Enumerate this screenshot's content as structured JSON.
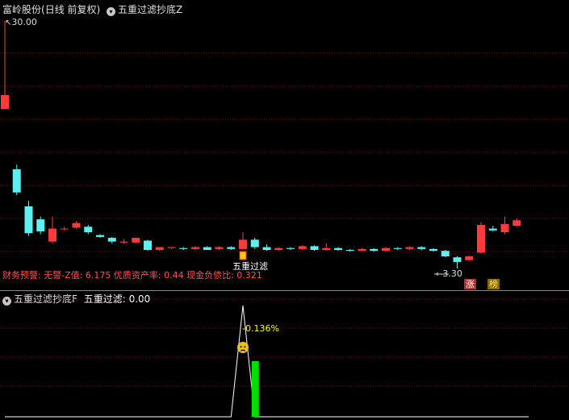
{
  "header": {
    "stock_name": "富岭股份",
    "period": "(日线 前复权)",
    "indicator_name": "五重过滤抄底Z"
  },
  "main_chart": {
    "high_label": "30.00",
    "low_label": "3.30",
    "signal_label": "五重过滤",
    "finance_warning": "财务预警: 无警-Z值: 6.175 优质资产率: 0.44 现金负债比: 0.321",
    "badges": [
      "涨",
      "榜"
    ],
    "colors": {
      "up": "#ff3a3a",
      "down": "#5cf0f0",
      "grid": "#7a0000",
      "badge_up": "#b03030",
      "badge_list": "#c8a000"
    }
  },
  "sub_chart": {
    "title": "五重过滤抄底F",
    "value_label": "五重过滤: 0.00",
    "pct_label": "-0.136%",
    "face_icon": "sad-face-icon",
    "colors": {
      "bar": "#00e000",
      "line": "#ffffff",
      "pct_text": "#ffff00"
    }
  },
  "chart_data": {
    "type": "candlestick",
    "title": "五重过滤抄底Z",
    "candles": [
      {
        "o": 22.0,
        "c": 20.5,
        "h": 30.0,
        "l": 20.5,
        "up": true
      },
      {
        "o": 14.0,
        "c": 11.5,
        "h": 14.5,
        "l": 11.2,
        "up": false
      },
      {
        "o": 10.0,
        "c": 7.1,
        "h": 10.6,
        "l": 6.8,
        "up": false
      },
      {
        "o": 8.6,
        "c": 7.3,
        "h": 8.9,
        "l": 7.0,
        "up": false
      },
      {
        "o": 6.2,
        "c": 7.6,
        "h": 8.9,
        "l": 6.0,
        "up": true
      },
      {
        "o": 7.6,
        "c": 7.6,
        "h": 7.8,
        "l": 7.4,
        "up": true
      },
      {
        "o": 7.7,
        "c": 8.2,
        "h": 8.4,
        "l": 7.6,
        "up": true
      },
      {
        "o": 7.8,
        "c": 7.2,
        "h": 8.0,
        "l": 7.0,
        "up": false
      },
      {
        "o": 6.9,
        "c": 6.7,
        "h": 7.0,
        "l": 6.6,
        "up": false
      },
      {
        "o": 6.6,
        "c": 6.2,
        "h": 6.7,
        "l": 6.0,
        "up": false
      },
      {
        "o": 6.1,
        "c": 6.2,
        "h": 6.5,
        "l": 6.0,
        "up": true
      },
      {
        "o": 6.1,
        "c": 6.6,
        "h": 6.6,
        "l": 6.0,
        "up": true
      },
      {
        "o": 6.3,
        "c": 5.3,
        "h": 6.4,
        "l": 5.2,
        "up": false
      },
      {
        "o": 5.3,
        "c": 5.6,
        "h": 5.6,
        "l": 5.2,
        "up": true
      },
      {
        "o": 5.5,
        "c": 5.6,
        "h": 5.6,
        "l": 5.4,
        "up": true
      },
      {
        "o": 5.5,
        "c": 5.4,
        "h": 5.6,
        "l": 5.3,
        "up": false
      },
      {
        "o": 5.4,
        "c": 5.6,
        "h": 5.7,
        "l": 5.3,
        "up": true
      },
      {
        "o": 5.6,
        "c": 5.3,
        "h": 5.7,
        "l": 5.3,
        "up": false
      },
      {
        "o": 5.4,
        "c": 5.6,
        "h": 5.7,
        "l": 5.3,
        "up": true
      },
      {
        "o": 5.6,
        "c": 5.4,
        "h": 5.7,
        "l": 5.3,
        "up": false
      },
      {
        "o": 5.4,
        "c": 6.4,
        "h": 7.2,
        "l": 5.3,
        "up": true
      },
      {
        "o": 6.4,
        "c": 5.6,
        "h": 6.6,
        "l": 5.4,
        "up": false
      },
      {
        "o": 5.6,
        "c": 5.3,
        "h": 5.9,
        "l": 5.2,
        "up": false
      },
      {
        "o": 5.3,
        "c": 5.5,
        "h": 5.6,
        "l": 5.2,
        "up": true
      },
      {
        "o": 5.5,
        "c": 5.4,
        "h": 5.6,
        "l": 5.3,
        "up": false
      },
      {
        "o": 5.4,
        "c": 5.7,
        "h": 5.8,
        "l": 5.3,
        "up": true
      },
      {
        "o": 5.7,
        "c": 5.3,
        "h": 5.8,
        "l": 5.2,
        "up": false
      },
      {
        "o": 5.3,
        "c": 5.5,
        "h": 6.0,
        "l": 5.2,
        "up": true
      },
      {
        "o": 5.5,
        "c": 5.3,
        "h": 5.6,
        "l": 5.2,
        "up": false
      },
      {
        "o": 5.3,
        "c": 5.2,
        "h": 5.4,
        "l": 5.1,
        "up": false
      },
      {
        "o": 5.2,
        "c": 5.4,
        "h": 5.5,
        "l": 5.2,
        "up": true
      },
      {
        "o": 5.4,
        "c": 5.2,
        "h": 5.5,
        "l": 5.1,
        "up": false
      },
      {
        "o": 5.2,
        "c": 5.5,
        "h": 5.6,
        "l": 5.1,
        "up": true
      },
      {
        "o": 5.5,
        "c": 5.4,
        "h": 5.6,
        "l": 5.3,
        "up": false
      },
      {
        "o": 5.4,
        "c": 5.6,
        "h": 5.7,
        "l": 5.3,
        "up": true
      },
      {
        "o": 5.6,
        "c": 5.4,
        "h": 5.7,
        "l": 5.3,
        "up": false
      },
      {
        "o": 5.4,
        "c": 5.2,
        "h": 5.5,
        "l": 5.1,
        "up": false
      },
      {
        "o": 5.2,
        "c": 4.6,
        "h": 5.3,
        "l": 4.5,
        "up": false
      },
      {
        "o": 4.5,
        "c": 4.0,
        "h": 4.6,
        "l": 3.3,
        "up": false
      },
      {
        "o": 4.2,
        "c": 4.6,
        "h": 4.7,
        "l": 4.1,
        "up": true
      },
      {
        "o": 5.0,
        "c": 8.0,
        "h": 8.3,
        "l": 4.9,
        "up": true
      },
      {
        "o": 7.6,
        "c": 7.4,
        "h": 7.9,
        "l": 7.3,
        "up": false
      },
      {
        "o": 7.2,
        "c": 8.1,
        "h": 8.9,
        "l": 7.0,
        "up": true
      },
      {
        "o": 7.9,
        "c": 8.5,
        "h": 8.7,
        "l": 7.8,
        "up": true
      }
    ],
    "subchart_line": [
      0,
      0,
      0,
      0,
      0,
      0,
      0,
      0,
      0,
      0,
      0,
      0,
      0,
      0,
      0,
      0,
      0,
      0,
      0,
      1,
      0,
      0,
      0,
      0,
      0,
      0,
      0,
      0,
      0,
      0,
      0,
      0,
      0,
      0,
      0,
      0,
      0,
      0,
      0,
      0,
      0,
      0,
      0,
      0
    ],
    "subchart_bar_index": 20,
    "subchart_bar_value": 0.5,
    "ylim": [
      3.3,
      30.0
    ]
  }
}
